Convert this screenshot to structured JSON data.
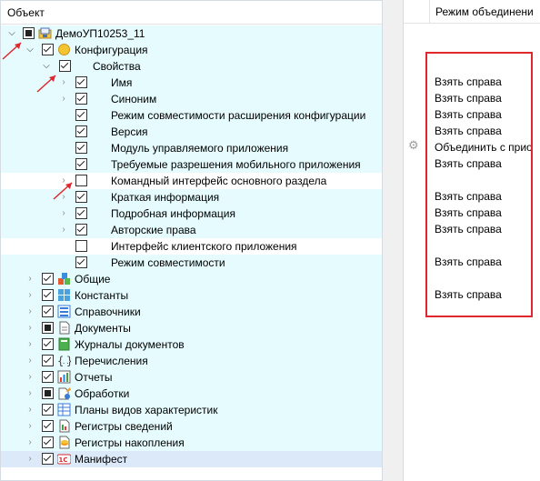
{
  "left_header": "Объект",
  "right_header": "Режим объединени",
  "root": {
    "label": "ДемоУП10253_11",
    "state": "partial",
    "expanded": true
  },
  "config": {
    "label": "Конфигурация",
    "state": "checked",
    "expanded": true
  },
  "props": {
    "label": "Свойства",
    "state": "checked",
    "expanded": true
  },
  "properties": [
    {
      "label": "Имя",
      "state": "checked",
      "arrow": true,
      "mode": "Взять справа"
    },
    {
      "label": "Синоним",
      "state": "checked",
      "arrow": true,
      "mode": "Взять справа"
    },
    {
      "label": "Режим совместимости расширения конфигурации",
      "state": "checked",
      "arrow": false,
      "mode": "Взять справа"
    },
    {
      "label": "Версия",
      "state": "checked",
      "arrow": false,
      "mode": "Взять справа"
    },
    {
      "label": "Модуль управляемого приложения",
      "state": "checked",
      "arrow": false,
      "mode": "Объединить с прио"
    },
    {
      "label": "Требуемые разрешения мобильного приложения",
      "state": "checked",
      "arrow": false,
      "mode": "Взять справа"
    },
    {
      "label": "Командный интерфейс основного раздела",
      "state": "unchecked",
      "arrow": true,
      "mode": ""
    },
    {
      "label": "Краткая информация",
      "state": "checked",
      "arrow": true,
      "mode": "Взять справа"
    },
    {
      "label": "Подробная информация",
      "state": "checked",
      "arrow": true,
      "mode": "Взять справа"
    },
    {
      "label": "Авторские права",
      "state": "checked",
      "arrow": true,
      "mode": "Взять справа"
    },
    {
      "label": "Интерфейс клиентского приложения",
      "state": "unchecked",
      "arrow": false,
      "mode": ""
    },
    {
      "label": "Режим совместимости",
      "state": "checked",
      "arrow": false,
      "mode": "Взять справа"
    }
  ],
  "groups": [
    {
      "label": "Общие",
      "state": "checked",
      "icon": "common-icon",
      "mode": ""
    },
    {
      "label": "Константы",
      "state": "checked",
      "icon": "constants-icon",
      "mode": "Взять справа"
    },
    {
      "label": "Справочники",
      "state": "checked",
      "icon": "catalogs-icon",
      "mode": ""
    },
    {
      "label": "Документы",
      "state": "partial",
      "icon": "documents-icon",
      "mode": ""
    },
    {
      "label": "Журналы документов",
      "state": "checked",
      "icon": "document-journals-icon",
      "mode": ""
    },
    {
      "label": "Перечисления",
      "state": "checked",
      "icon": "enums-icon",
      "mode": ""
    },
    {
      "label": "Отчеты",
      "state": "checked",
      "icon": "reports-icon",
      "mode": ""
    },
    {
      "label": "Обработки",
      "state": "partial",
      "icon": "data-processors-icon",
      "mode": ""
    },
    {
      "label": "Планы видов характеристик",
      "state": "checked",
      "icon": "characteristic-types-icon",
      "mode": ""
    },
    {
      "label": "Регистры сведений",
      "state": "checked",
      "icon": "information-registers-icon",
      "mode": ""
    },
    {
      "label": "Регистры накопления",
      "state": "checked",
      "icon": "accumulation-registers-icon",
      "mode": ""
    },
    {
      "label": "Манифест",
      "state": "checked",
      "icon": "manifest-icon",
      "mode": ""
    }
  ],
  "colors": {
    "row_bg": "#e5fbfe",
    "selected_bg": "#dbe9f9",
    "annotation_red": "#e0262e"
  },
  "icons": {
    "settings": "gear-icon"
  }
}
